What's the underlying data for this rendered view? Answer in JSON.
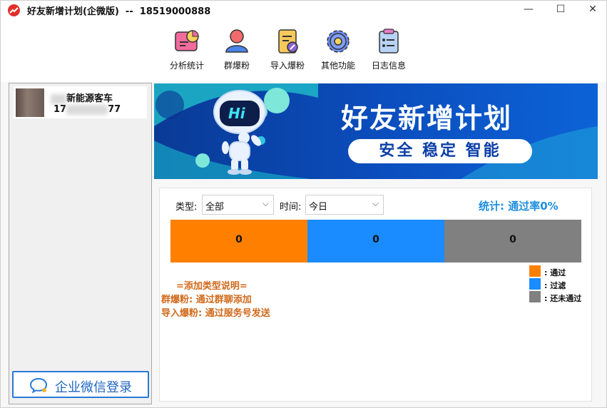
{
  "window": {
    "title": "好友新增计划(企微版)  --  18519000888",
    "minimize": "—",
    "maximize": "☐",
    "close": "✕"
  },
  "toolbar": {
    "items": [
      {
        "label": "分析统计",
        "icon": "chart-icon"
      },
      {
        "label": "群爆粉",
        "icon": "user-icon"
      },
      {
        "label": "导入爆粉",
        "icon": "import-icon"
      },
      {
        "label": "其他功能",
        "icon": "gear-icon"
      },
      {
        "label": "日志信息",
        "icon": "log-icon"
      }
    ]
  },
  "sidebar": {
    "account": {
      "name": "新能源客车",
      "phone": "77"
    },
    "login_label": "企业微信登录"
  },
  "banner": {
    "robot_text": "Hi",
    "title": "好友新增计划",
    "subtitle": "安全 稳定 智能"
  },
  "stats": {
    "type_label": "类型:",
    "type_value": "全部",
    "time_label": "时间:",
    "time_value": "今日",
    "rate_text": "统计: 通过率0%",
    "bars": [
      {
        "value": "0",
        "color": "#ff8000"
      },
      {
        "value": "0",
        "color": "#1a8cff"
      },
      {
        "value": "0",
        "color": "#808080"
      }
    ],
    "legend": [
      {
        "label": ": 通过",
        "color": "#ff8000"
      },
      {
        "label": ": 过滤",
        "color": "#1a8cff"
      },
      {
        "label": ": 还未通过",
        "color": "#808080"
      }
    ],
    "notes": {
      "header": "=添加类型说明=",
      "line1": "群爆粉: 通过群聊添加",
      "line2": "导入爆粉: 通过服务号发送"
    }
  }
}
